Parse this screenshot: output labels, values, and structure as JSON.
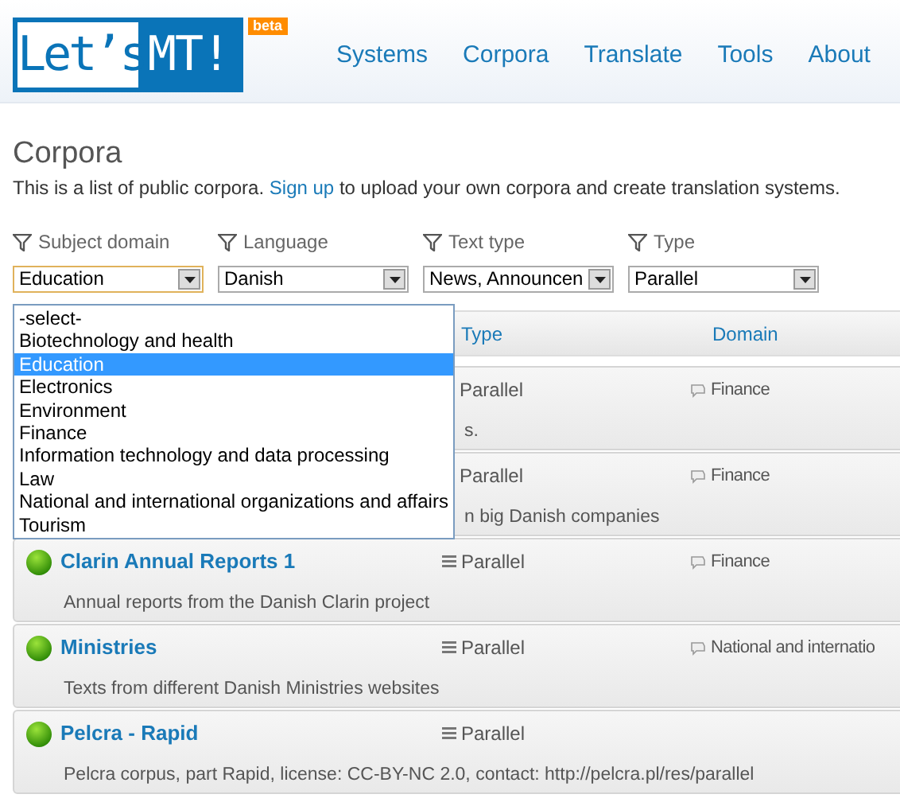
{
  "logo": {
    "left": "Let’s",
    "right": "MT!",
    "badge": "beta"
  },
  "nav": [
    {
      "label": "Systems"
    },
    {
      "label": "Corpora"
    },
    {
      "label": "Translate"
    },
    {
      "label": "Tools"
    },
    {
      "label": "About"
    }
  ],
  "page": {
    "title": "Corpora",
    "intro_before": "This is a list of public corpora.",
    "intro_link": "Sign up",
    "intro_after": "to upload your own corpora and create translation systems."
  },
  "filters": [
    {
      "label": "Subject domain",
      "value": "Education",
      "focused": true
    },
    {
      "label": "Language",
      "value": "Danish",
      "focused": false
    },
    {
      "label": "Text type",
      "value": "News, Announcen",
      "focused": false
    },
    {
      "label": "Type",
      "value": "Parallel",
      "focused": false
    }
  ],
  "dropdown": {
    "options": [
      {
        "label": "-select-",
        "selected": false
      },
      {
        "label": "Biotechnology and health",
        "selected": false
      },
      {
        "label": "Education",
        "selected": true
      },
      {
        "label": "Electronics",
        "selected": false
      },
      {
        "label": "Environment",
        "selected": false
      },
      {
        "label": "Finance",
        "selected": false
      },
      {
        "label": "Information technology and data processing",
        "selected": false
      },
      {
        "label": "Law",
        "selected": false
      },
      {
        "label": "National and international organizations and affairs",
        "selected": false
      },
      {
        "label": "Tourism",
        "selected": false
      }
    ]
  },
  "table": {
    "columns": [
      "Type",
      "Domain"
    ],
    "rows": [
      {
        "kind": "covered",
        "type": "Parallel",
        "domain": "Finance",
        "description": "s."
      },
      {
        "kind": "covered",
        "type": "Parallel",
        "domain": "Finance",
        "description": "n big Danish companies"
      },
      {
        "kind": "full",
        "name": "Clarin Annual Reports 1",
        "type": "Parallel",
        "domain": "Finance",
        "description": "Annual reports from the Danish Clarin project"
      },
      {
        "kind": "full",
        "name": "Ministries",
        "type": "Parallel",
        "domain": "National and internatio",
        "description": "Texts from different Danish Ministries websites"
      },
      {
        "kind": "full",
        "name": "Pelcra - Rapid",
        "type": "Parallel",
        "description": "Pelcra corpus, part Rapid, license: CC-BY-NC 2.0, contact: http://pelcra.pl/res/parallel"
      }
    ]
  }
}
